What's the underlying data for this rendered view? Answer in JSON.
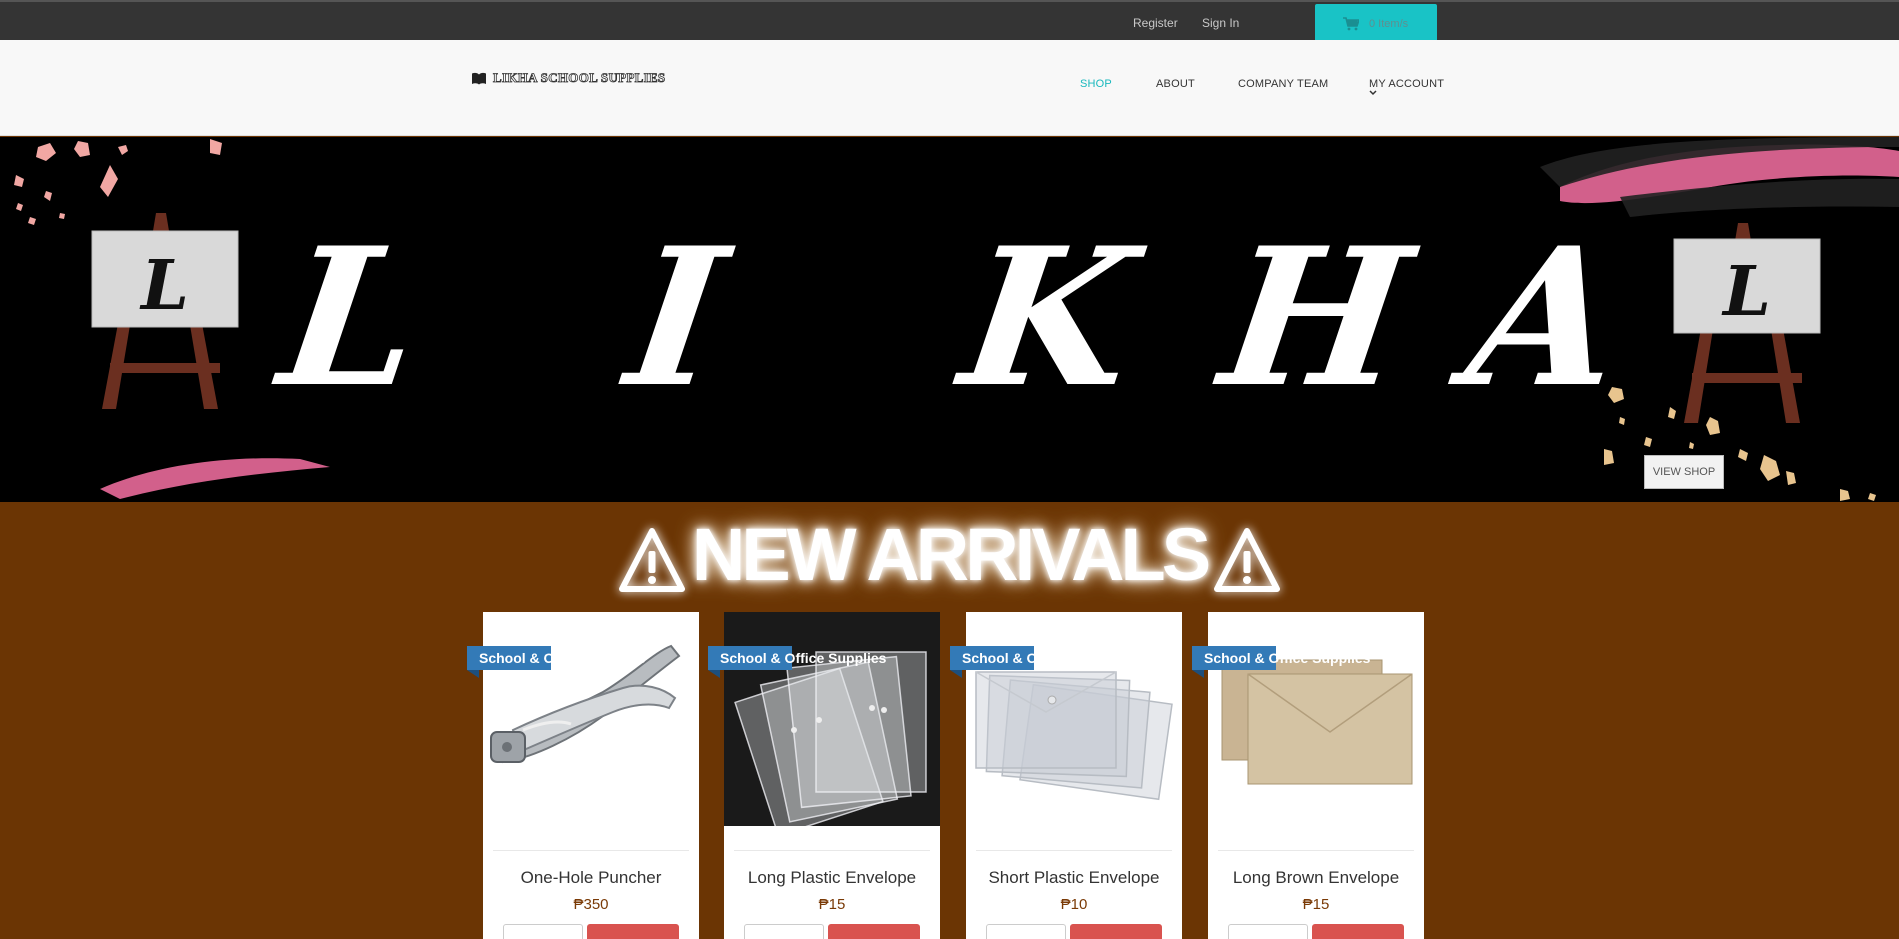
{
  "topbar": {
    "register": "Register",
    "sign_in": "Sign In",
    "cart_count": "0 Item/s",
    "cart_icon": "cart-icon",
    "accent": "#19c3c6"
  },
  "header": {
    "logo_text": "LIKHA SCHOOL SUPPLIES",
    "logo_icon": "open-book-icon",
    "nav": {
      "shop": "SHOP",
      "about": "ABOUT",
      "team": "COMPANY TEAM",
      "account": "MY ACCOUNT"
    },
    "active_color": "#19b8bd"
  },
  "banner": {
    "letters": [
      "L",
      "I",
      "K",
      "H",
      "A"
    ],
    "easel_letter": "L",
    "view_shop": "VIEW SHOP"
  },
  "arrivals": {
    "title": "NEW ARRIVALS",
    "icon": "warning-icon",
    "background": "#6b3504"
  },
  "products": [
    {
      "category": "School & Office Supplies",
      "name": "One-Hole Puncher",
      "price": "₱350"
    },
    {
      "category": "School & Office Supplies",
      "name": "Long Plastic Envelope",
      "price": "₱15"
    },
    {
      "category": "School & Office Supplies",
      "name": "Short Plastic Envelope",
      "price": "₱10"
    },
    {
      "category": "School & Office Supplies",
      "name": "Long Brown Envelope",
      "price": "₱15"
    }
  ]
}
